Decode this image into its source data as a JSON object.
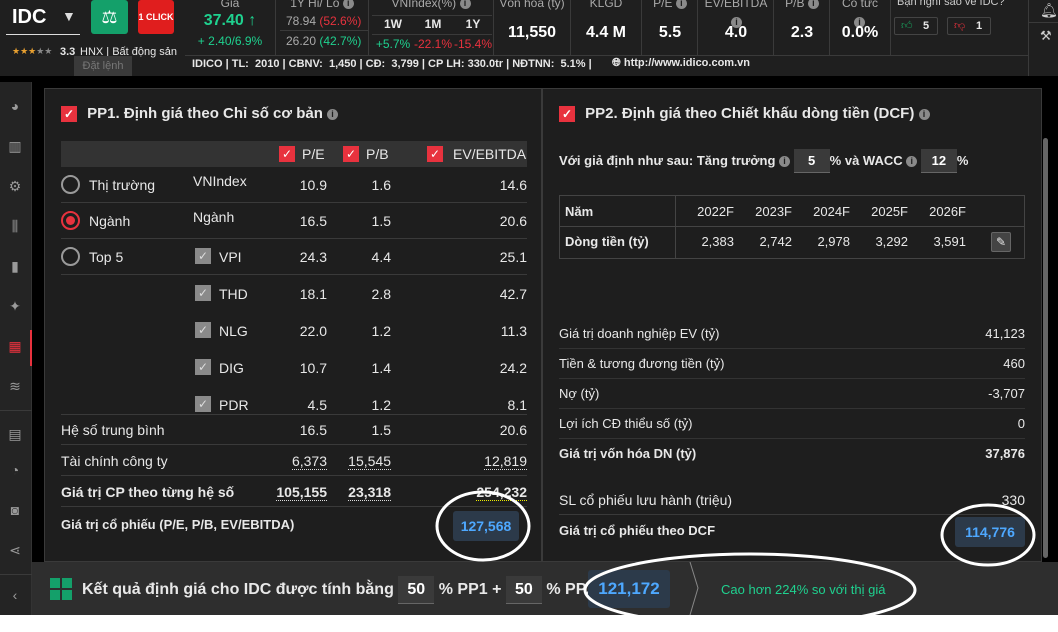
{
  "header": {
    "ticker": "IDC",
    "order_tooltip": "Đặt lệnh",
    "one_click": "1 CLICK",
    "rating": "3.3",
    "exchange_sector": "HNX | Bất động sản",
    "price_label": "Giá",
    "price": "37.40",
    "price_change": "+ 2.40/6.9%",
    "hilo_label": "1Y Hi/ Lo",
    "hi": "78.94",
    "hi_pct": "(52.6%)",
    "lo": "26.20",
    "lo_pct": "(42.7%)",
    "vnindex_label": "VNIndex(%)",
    "vn_periods": [
      "1W",
      "1M",
      "1Y"
    ],
    "vn_values": [
      "+5.7%",
      "-22.1%",
      "-15.4%"
    ],
    "metrics": [
      {
        "label": "Vốn hóa (tỷ)",
        "value": "11,550"
      },
      {
        "label": "KLGD",
        "value": "4.4 M"
      },
      {
        "label": "P/E",
        "value": "5.5"
      },
      {
        "label": "EV/EBITDA",
        "value": "4.0"
      },
      {
        "label": "P/B",
        "value": "2.3"
      },
      {
        "label": "Cổ tức",
        "value": "0.0%"
      }
    ],
    "poll_label": "Bạn nghĩ sao về IDC?",
    "likes": "5",
    "dislikes": "1",
    "info_line": "IDICO | TL:  2010 | CBNV:  1,450 | CĐ:  3,799 | CP LH: 330.0tr | NĐTNN:  5.1% |",
    "website": "http://www.idico.com.vn"
  },
  "pp1": {
    "title": "PP1. Định giá theo Chỉ số cơ bản",
    "cols": [
      "P/E",
      "P/B",
      "EV/EBITDA"
    ],
    "rows": [
      {
        "group": "Thị trường",
        "name": "VNIndex",
        "v": [
          "10.9",
          "1.6",
          "14.6"
        ]
      },
      {
        "group": "Ngành",
        "name": "Ngành",
        "v": [
          "16.5",
          "1.5",
          "20.6"
        ]
      },
      {
        "group": "Top 5",
        "name": "VPI",
        "v": [
          "24.3",
          "4.4",
          "25.1"
        ]
      },
      {
        "group": "",
        "name": "THD",
        "v": [
          "18.1",
          "2.8",
          "42.7"
        ]
      },
      {
        "group": "",
        "name": "NLG",
        "v": [
          "22.0",
          "1.2",
          "11.3"
        ]
      },
      {
        "group": "",
        "name": "DIG",
        "v": [
          "10.7",
          "1.4",
          "24.2"
        ]
      },
      {
        "group": "",
        "name": "PDR",
        "v": [
          "4.5",
          "1.2",
          "8.1"
        ]
      }
    ],
    "avg": {
      "label": "Hệ số trung bình",
      "v": [
        "16.5",
        "1.5",
        "20.6"
      ]
    },
    "fin": {
      "label": "Tài chính công ty",
      "v": [
        "6,373",
        "15,545",
        "12,819"
      ]
    },
    "each": {
      "label": "Giá trị CP theo từng hệ số",
      "v": [
        "105,155",
        "23,318",
        "254,232"
      ]
    },
    "result": {
      "label": "Giá trị cổ phiếu (P/E, P/B, EV/EBITDA)",
      "value": "127,568"
    }
  },
  "pp2": {
    "title": "PP2. Định giá theo Chiết khấu dòng tiền (DCF)",
    "assume_label": "Với giả định như sau: Tăng trưởng",
    "growth": "5",
    "wacc_label": "% và WACC",
    "wacc": "12",
    "pct": "%",
    "year_label": "Năm",
    "years": [
      "2022F",
      "2023F",
      "2024F",
      "2025F",
      "2026F"
    ],
    "cf_label": "Dòng tiền (tỷ)",
    "cf": [
      "2,383",
      "2,742",
      "2,978",
      "3,292",
      "3,591"
    ],
    "items": [
      {
        "label": "Giá trị doanh nghiệp EV (tỷ)",
        "value": "41,123"
      },
      {
        "label": "Tiền & tương đương tiền (tỷ)",
        "value": "460"
      },
      {
        "label": "Nợ (tỷ)",
        "value": "-3,707"
      },
      {
        "label": "Lợi ích CĐ thiểu số (tỷ)",
        "value": "0"
      },
      {
        "label": "Giá trị vốn hóa DN (tỷ)",
        "value": "37,876"
      }
    ],
    "shares": {
      "label": "SL cổ phiếu lưu hành (triệu)",
      "value": "330"
    },
    "result": {
      "label": "Giá trị cổ phiếu theo DCF",
      "value": "114,776"
    }
  },
  "footer": {
    "text1": "Kết quả định giá cho IDC được tính bằng",
    "w1": "50",
    "text2": "% PP1 +",
    "w2": "50",
    "text3": "% PP2 là:",
    "value": "121,172",
    "compare": "Cao hơn 224% so với thị giá"
  }
}
